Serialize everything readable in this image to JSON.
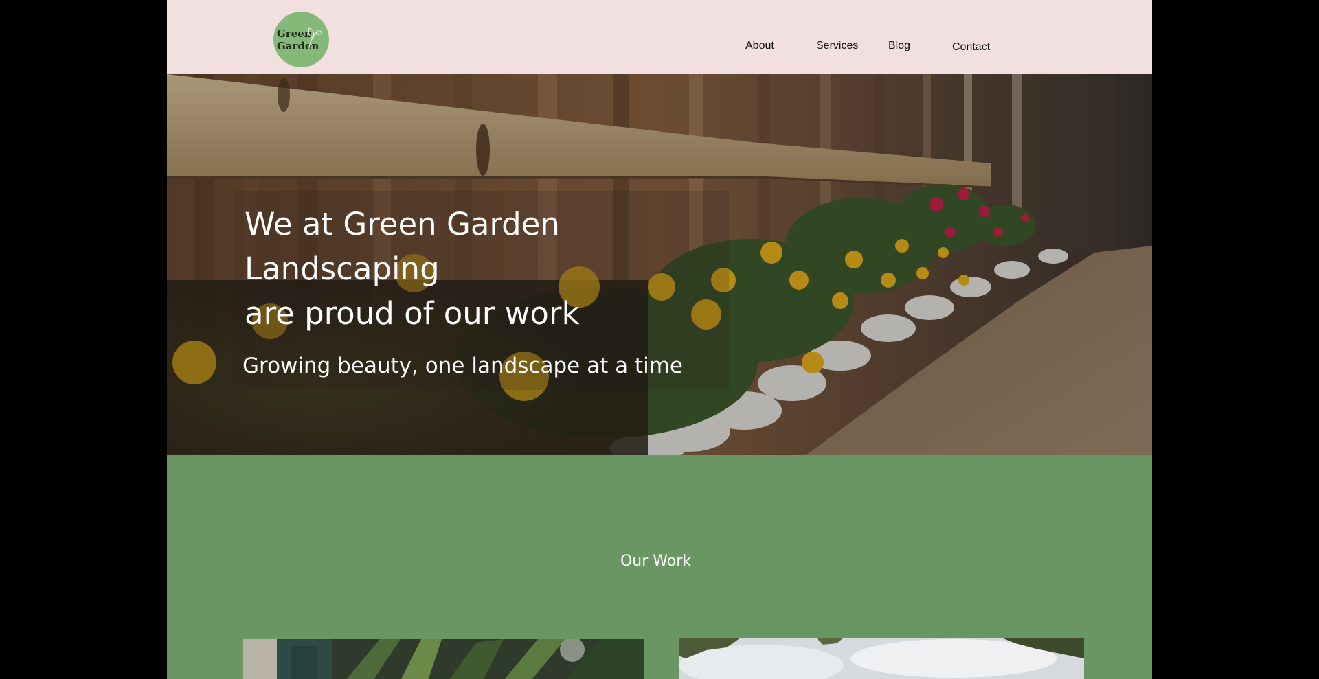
{
  "logo": {
    "line1": "Green",
    "line2": "Garden",
    "icon": "leaf-icon",
    "color": "#84b979"
  },
  "nav": {
    "items": [
      {
        "label": "About"
      },
      {
        "label": "Services"
      },
      {
        "label": "Blog"
      },
      {
        "label": "Contact"
      }
    ]
  },
  "hero": {
    "title_lines": [
      "We at Green Garden",
      "Landscaping",
      "are proud of our work"
    ],
    "subtitle": "Growing beauty, one landscape at a time"
  },
  "work": {
    "title": "Our Work"
  },
  "colors": {
    "header_bg": "#f2e0e0",
    "section_green": "#6a9663",
    "page_bg": "#000000",
    "text_light": "#ffffff"
  }
}
